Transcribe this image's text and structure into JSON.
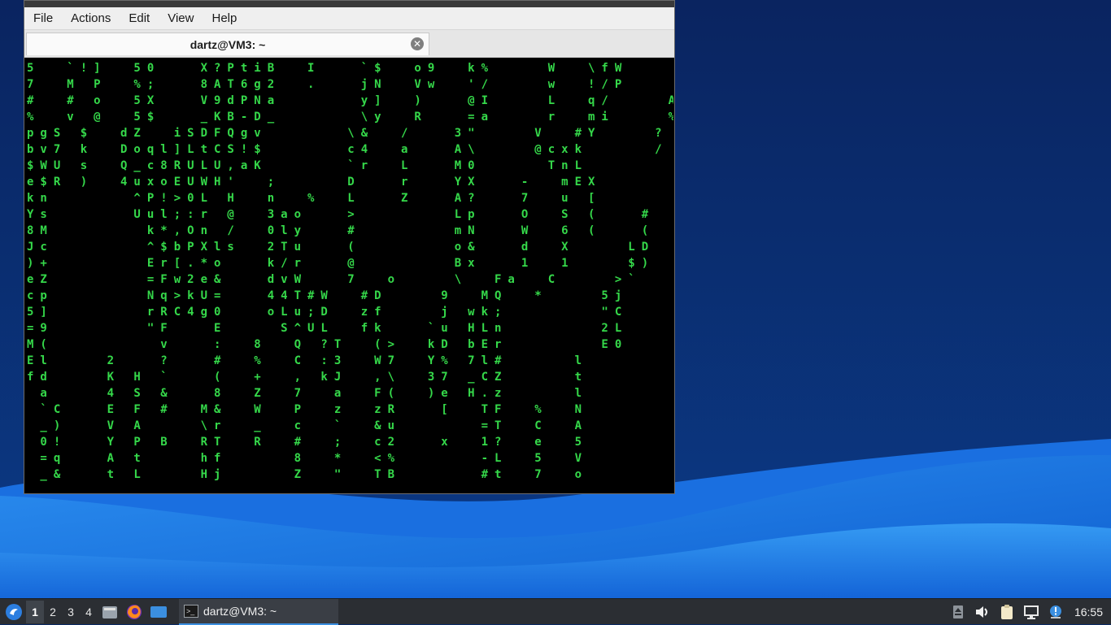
{
  "window": {
    "menu": [
      "File",
      "Actions",
      "Edit",
      "View",
      "Help"
    ],
    "tab_title": "dartz@VM3: ~",
    "tab_close_glyph": "✕"
  },
  "terminal": {
    "lines": [
      "5  `!]  50   X?PtiB  I   `$  o9  k%    W  \\fW",
      "7  M P  %;   8AT6g2  .   jN  Vw  '/    w  !/P",
      "#  # o  5X   V9dPNa      y]  )   @I    L  q/    A",
      "%  v @  5$   _KB-D_      \\y  R   =a    r  mi    %",
      "pgS $  dZ  iSDFQgv      \\&  /   3\"    V  #Y    ?",
      "bv7 k  Doql]LtCS!$      c4  a   A\\    @cxk     /",
      "$WU s  Q_c8RULU,aK      `r  L   M0     TnL",
      "e$R )  4uxoEUWH'  ;     D   r   YX   -  mEX",
      "kn      ^P!>0L H  n  %  L   Z   A?   7  u [",
      "Ys      Uul;:r @  3ao   >       Lp   O  S (   #",
      "8M       k*,On /  0ly   #       mN   W  6 (   (",
      "Jc       ^$bPXls  2Tu   (       o&   d  X    LD",
      ")+       Er[.*o   k/r   @       Bx   1  1    $)",
      "eZ       =Fw2e&   dvW   7  o    \\  Fa  C    >`",
      "cp       Nq>kU=   44T#W  #D    9  MQ  *    5j",
      "5]       rRC4g0   oLu;D  zf    j wk;       \"C",
      "=9       \"F   E    S^UL  fk   `u HLn       2L",
      "M(        v   :  8  Q ?T  (>  kD bEr       E0",
      "El    2   ?   #  %  C :3  W7  Y% 7l#     l",
      "fd    K H `   (  +  , kJ  ,\\  37 _CZ     t",
      " a    4 S &   8  Z  7  a  F(  )e H.z     l",
      " `C   E F #  M&  W  P  z  zR   [  TF  %  N",
      " _)   V A    \\r  _  c  `  &u      =T  C  A",
      " 0!   Y P B  RT  R  #  ;  c2   x  1?  e  5",
      " =q   A t    hf     8  *  <%      -L  5  V",
      " _&   t L    Hj     Z  \"  TB      #t  7  o"
    ]
  },
  "taskbar": {
    "workspaces": [
      "1",
      "2",
      "3",
      "4"
    ],
    "active_task": "dartz@VM3: ~",
    "clock": "16:55"
  }
}
